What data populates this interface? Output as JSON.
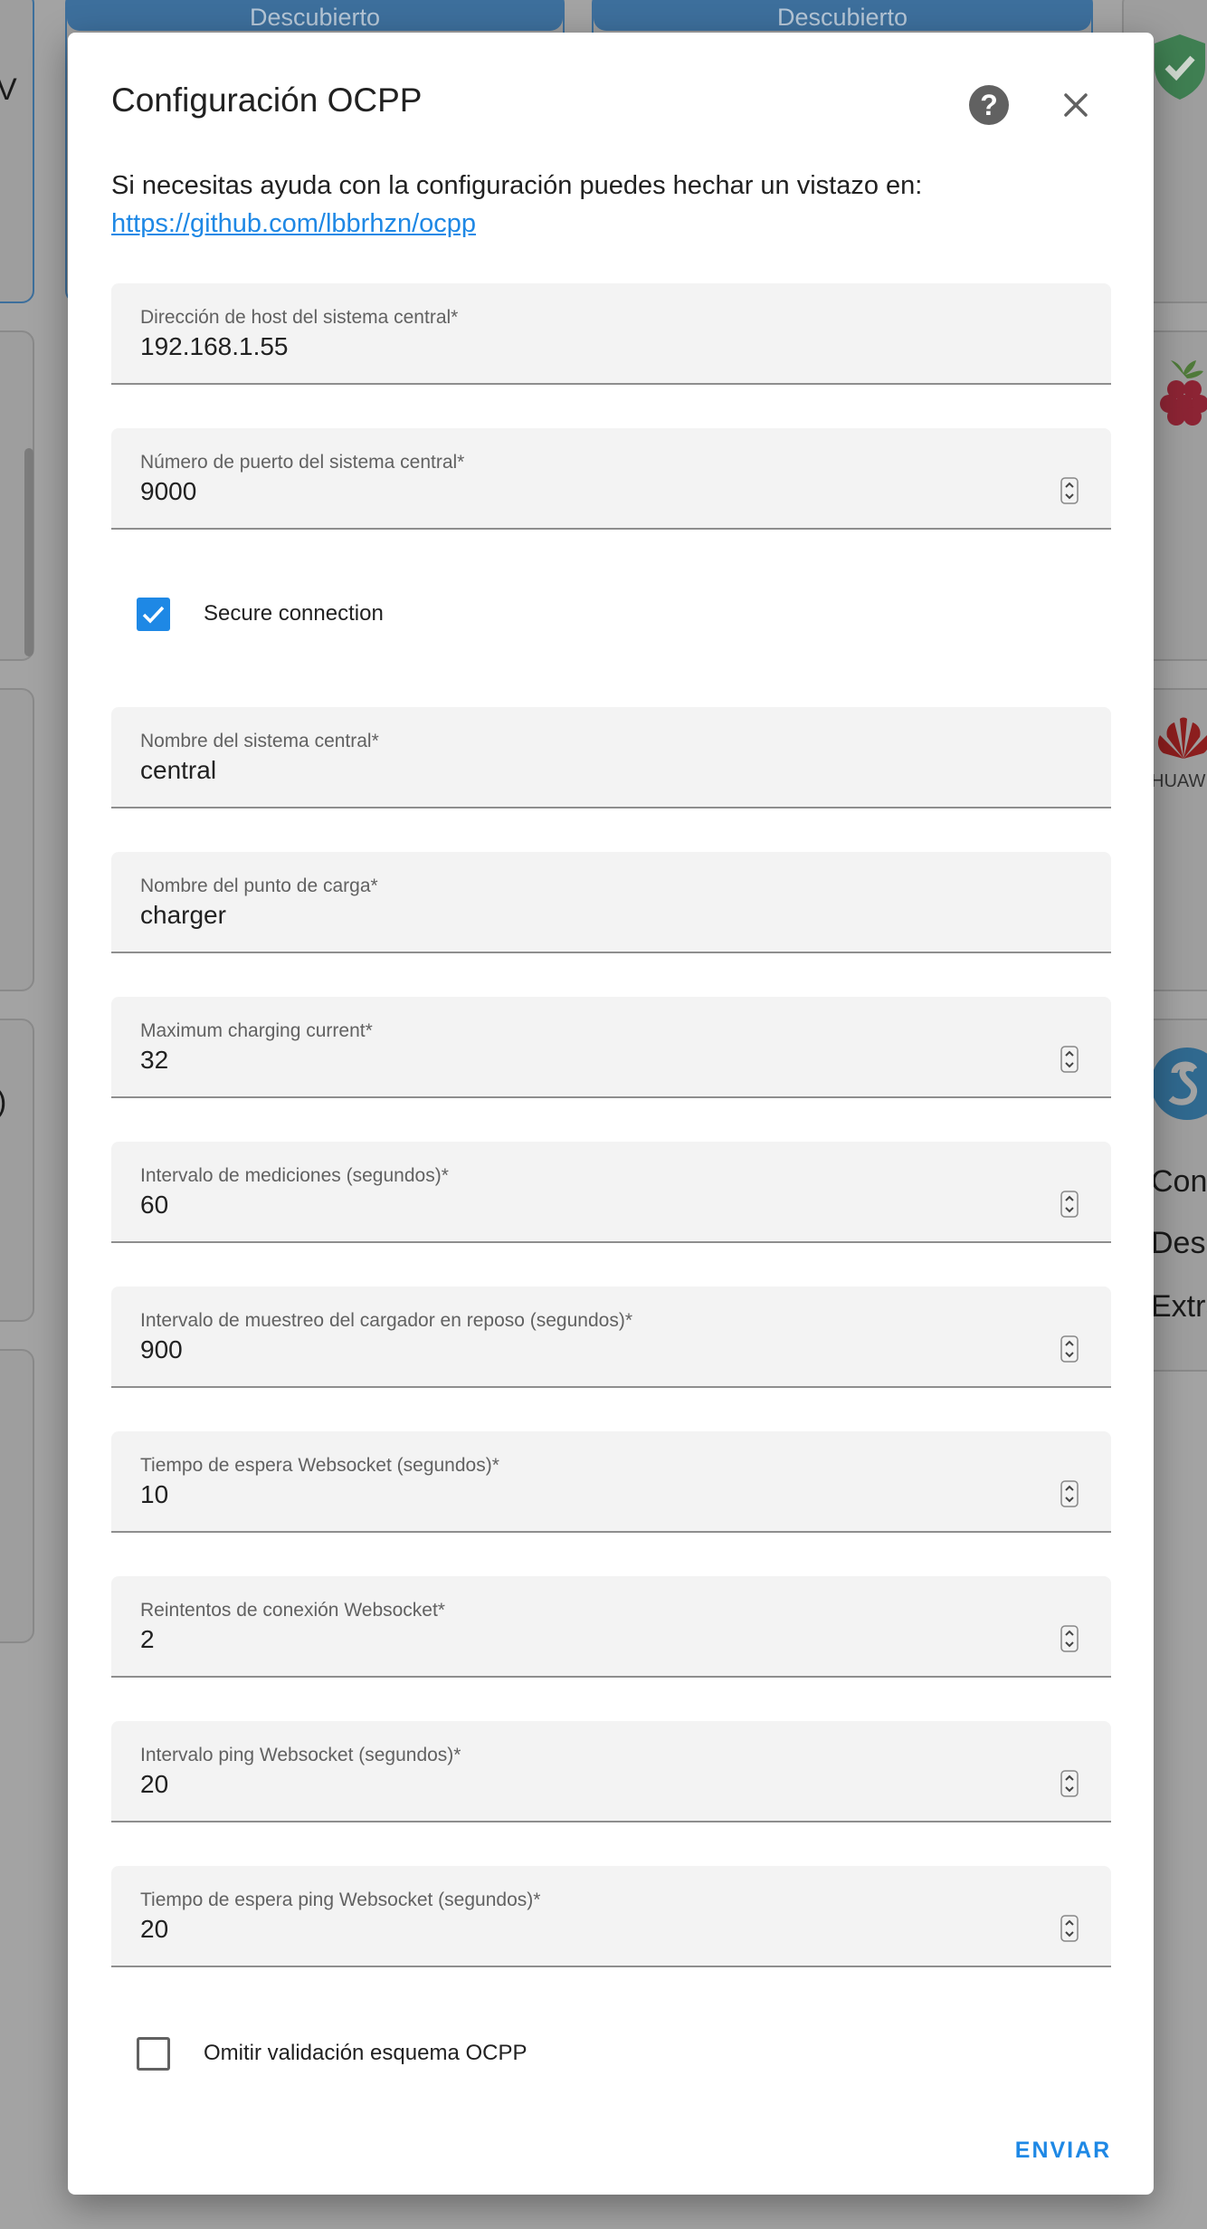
{
  "background": {
    "discover_buttons": [
      "Descubierto",
      "Descubierto"
    ],
    "left_fragments": [
      "V",
      ")"
    ],
    "right_fragments": [
      "HUAW",
      "Cont",
      "Desh",
      "Extra"
    ]
  },
  "dialog": {
    "title": "Configuración OCPP",
    "help_icon": "help-circle-icon",
    "close_icon": "close-icon",
    "intro_text": "Si necesitas ayuda con la configuración puedes hechar un vistazo en:",
    "intro_link": "https://github.com/lbbrhzn/ocpp",
    "fields": {
      "host": {
        "label": "Dirección de host del sistema central*",
        "value": "192.168.1.55"
      },
      "port": {
        "label": "Número de puerto del sistema central*",
        "value": "9000"
      },
      "csid": {
        "label": "Nombre del sistema central*",
        "value": "central"
      },
      "cpid": {
        "label": "Nombre del punto de carga*",
        "value": "charger"
      },
      "max_current": {
        "label": "Maximum charging current*",
        "value": "32"
      },
      "meter_interval": {
        "label": "Intervalo de mediciones (segundos)*",
        "value": "60"
      },
      "idle_interval": {
        "label": "Intervalo de muestreo del cargador en reposo (segundos)*",
        "value": "900"
      },
      "ws_timeout": {
        "label": "Tiempo de espera Websocket (segundos)*",
        "value": "10"
      },
      "ws_retries": {
        "label": "Reintentos de conexión Websocket*",
        "value": "2"
      },
      "ping_interval": {
        "label": "Intervalo ping Websocket (segundos)*",
        "value": "20"
      },
      "ping_timeout": {
        "label": "Tiempo de espera ping Websocket (segundos)*",
        "value": "20"
      }
    },
    "secure_connection": {
      "label": "Secure connection",
      "checked": true
    },
    "skip_schema": {
      "label": "Omitir validación esquema OCPP",
      "checked": false
    },
    "submit_label": "ENVIAR"
  },
  "colors": {
    "accent": "#1e88e5",
    "field_bg": "#f3f3f3",
    "scrim": "#a3a3a3"
  }
}
